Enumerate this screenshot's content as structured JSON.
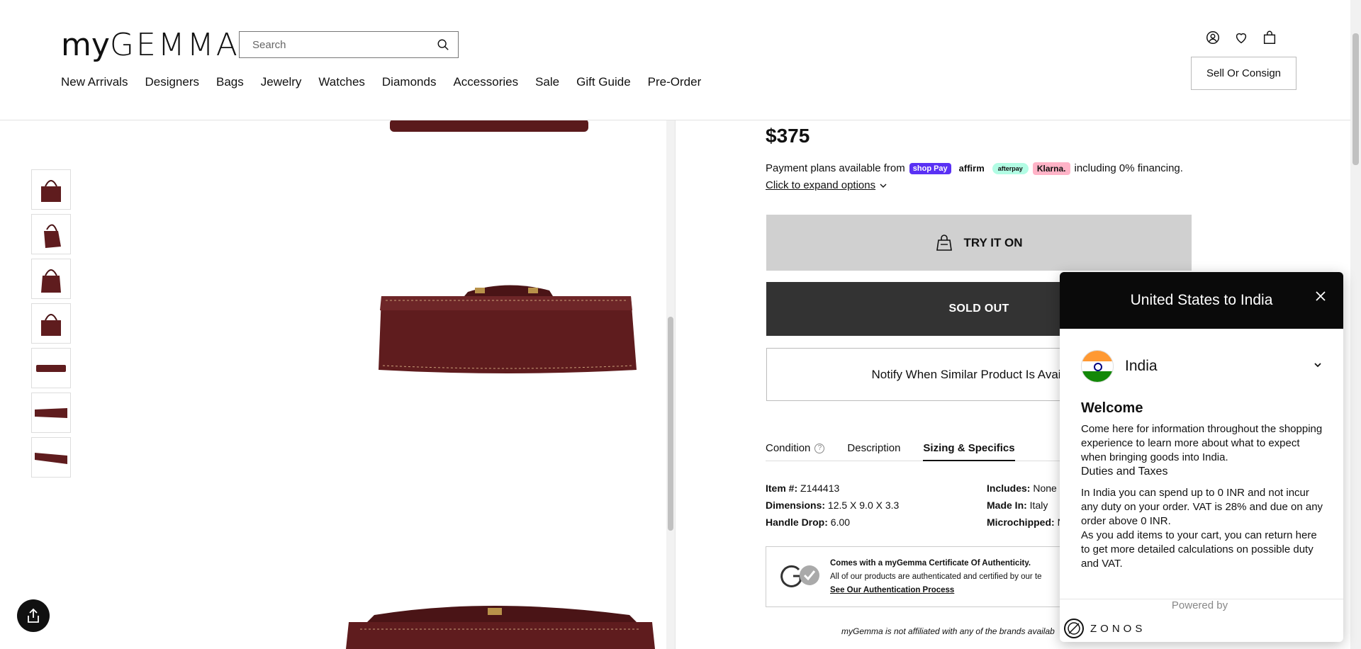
{
  "header": {
    "logo_my": "my",
    "logo_gemma": "GEMMA",
    "search_placeholder": "Search",
    "nav": [
      "New Arrivals",
      "Designers",
      "Bags",
      "Jewelry",
      "Watches",
      "Diamonds",
      "Accessories",
      "Sale",
      "Gift Guide",
      "Pre-Order"
    ],
    "sell_button": "Sell Or Consign"
  },
  "product": {
    "price": "$375",
    "payment_prefix": "Payment plans available from",
    "payment_suffix": "including 0% financing.",
    "payment_badges": {
      "shoppay": "shop Pay",
      "affirm": "affirm",
      "afterpay": "afterpay",
      "klarna": "Klarna."
    },
    "expand_options": "Click to expand options",
    "try_on": "TRY IT ON",
    "sold_out": "SOLD OUT",
    "notify": "Notify When Similar Product Is Available",
    "tabs": [
      "Condition",
      "Description",
      "Sizing & Specifics"
    ],
    "active_tab": "Sizing & Specifics",
    "specs_left": [
      {
        "label": "Item #:",
        "value": "Z144413"
      },
      {
        "label": "Dimensions:",
        "value": "12.5 X 9.0 X 3.3"
      },
      {
        "label": "Handle Drop:",
        "value": "6.00"
      }
    ],
    "specs_right": [
      {
        "label": "Includes:",
        "value": "None"
      },
      {
        "label": "Made In:",
        "value": "Italy"
      },
      {
        "label": "Microchipped:",
        "value": "N"
      }
    ],
    "certificate": {
      "title": "Comes with a myGemma Certificate Of Authenticity.",
      "body": "All of our products are authenticated and certified by our te",
      "link": "See Our Authentication Process"
    },
    "disclaimer": "myGemma is not affiliated with any of the brands availab"
  },
  "popup": {
    "title": "United States to India",
    "country": "India",
    "welcome": "Welcome",
    "welcome_text": "Come here for information throughout the shopping experience to learn more about what to expect when bringing goods into India.",
    "duties_title": "Duties and Taxes",
    "duties_text": "In India you can spend up to 0 INR and not incur any duty on your order. VAT is 28% and due on any order above 0 INR.",
    "return_text": "As you add items to your cart, you can return here to get more detailed calculations on possible duty and VAT.",
    "powered_by": "Powered by",
    "brand": "ZONOS"
  },
  "colors": {
    "leather": "#5a1a1c",
    "accent": "#111111",
    "shoppay": "#5a31f4",
    "klarna": "#ffb3c7",
    "afterpay": "#b2fce4"
  }
}
